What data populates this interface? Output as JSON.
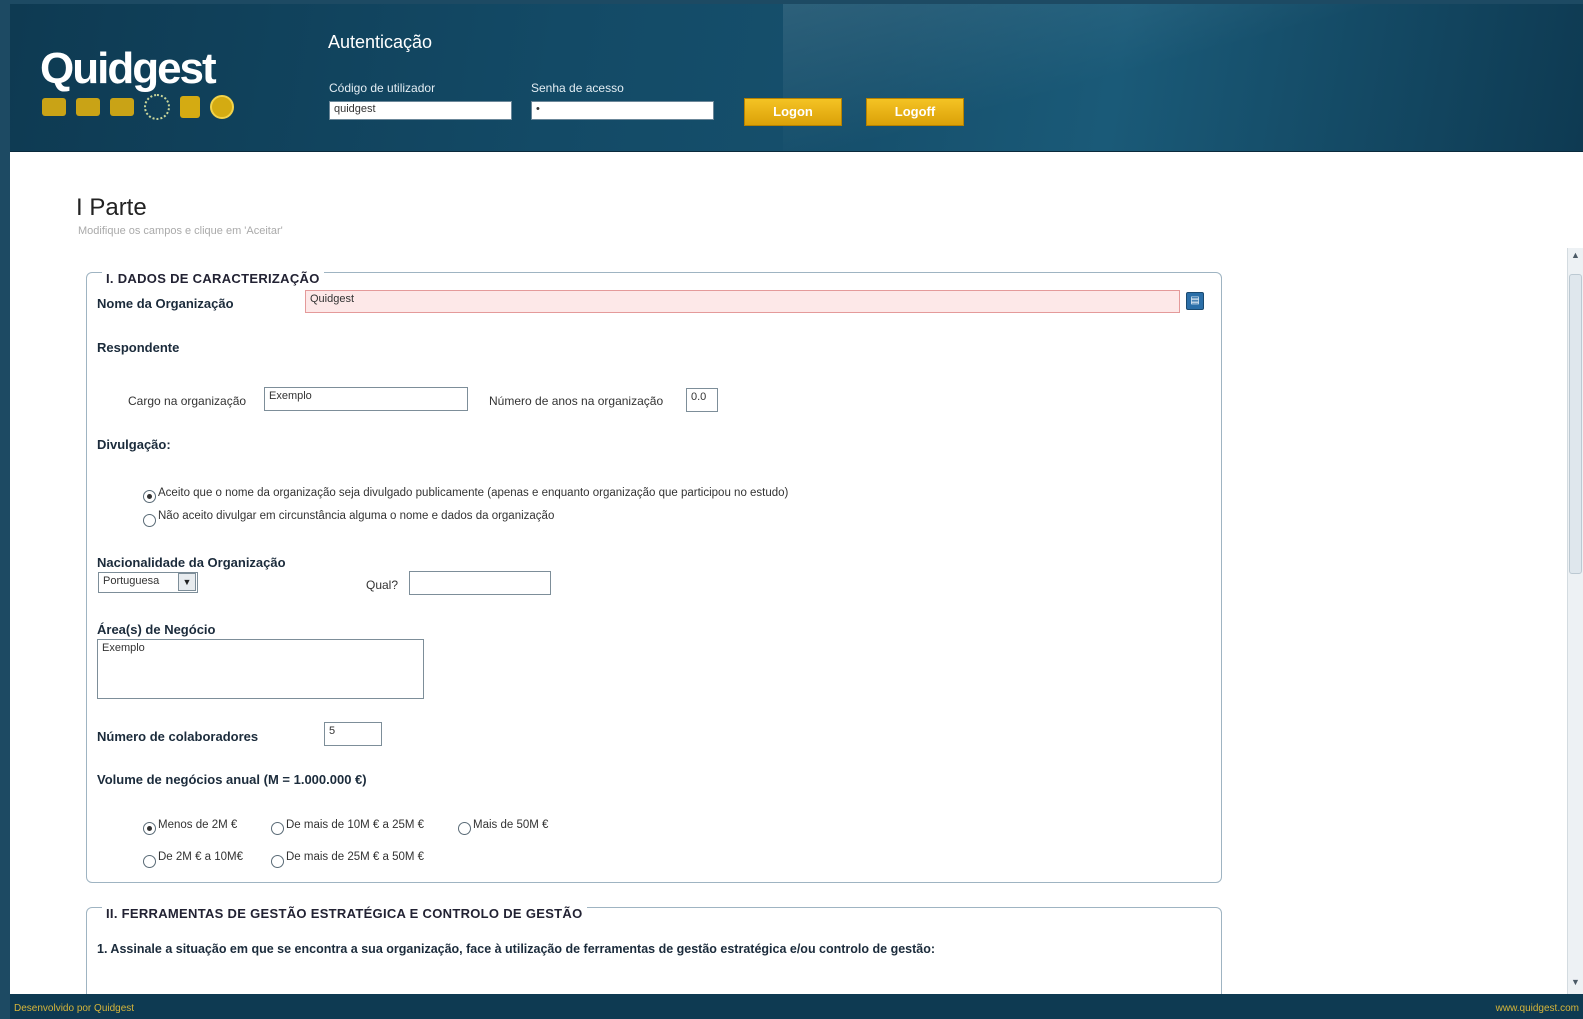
{
  "header": {
    "logo": "Quidgest",
    "auth_title": "Autenticação",
    "user_label": "Código de utilizador",
    "user_value": "quidgest",
    "password_label": "Senha de acesso",
    "password_value": "•",
    "logon_label": "Logon",
    "logoff_label": "Logoff"
  },
  "page": {
    "title": "I Parte",
    "subtitle": "Modifique os campos e clique em 'Aceitar'"
  },
  "section1": {
    "legend": "I. DADOS DE CARACTERIZAÇÃO",
    "org_name_label": "Nome da Organização",
    "org_name_value": "Quidgest",
    "respondent_label": "Respondente",
    "role_label": "Cargo na organização",
    "role_value": "Exemplo",
    "years_label": "Número de anos na organização",
    "years_value": "0.0",
    "disclosure_label": "Divulgação:",
    "disclosure_opt1": "Aceito que o nome da organização seja divulgado publicamente (apenas e enquanto organização que participou no estudo)",
    "disclosure_opt2": "Não aceito divulgar em circunstância alguma o nome e dados da organização",
    "nationality_label": "Nacionalidade da Organização",
    "nationality_value": "Portuguesa",
    "which_label": "Qual?",
    "which_value": "",
    "business_label": "Área(s) de Negócio",
    "business_value": "Exemplo",
    "employees_label": "Número de colaboradores",
    "employees_value": "5",
    "volume_label": "Volume de negócios anual (M = 1.000.000 €)",
    "volume_opt1": "Menos de 2M €",
    "volume_opt2": "De mais de 10M € a 25M €",
    "volume_opt3": "Mais de 50M €",
    "volume_opt4": "De 2M € a 10M€",
    "volume_opt5": "De mais de 25M € a 50M €"
  },
  "section2": {
    "legend": "II. FERRAMENTAS DE GESTÃO ESTRATÉGICA E CONTROLO DE GESTÃO",
    "question1": "1. Assinale a situação em que se encontra a sua organização, face à utilização de ferramentas de gestão estratégica e/ou controlo de gestão:"
  },
  "footer": {
    "left": "Desenvolvido por Quidgest",
    "right": "www.quidgest.com"
  },
  "icons": {
    "lookup": "lookup-icon",
    "dropdown": "chevron-down-icon"
  }
}
